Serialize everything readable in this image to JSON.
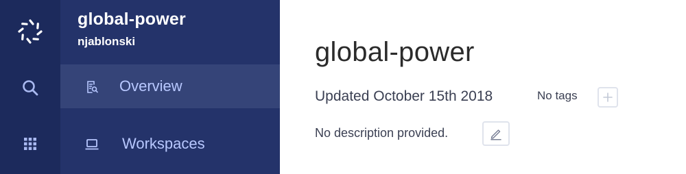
{
  "colors": {
    "rail_bg": "#1c2a5c",
    "sidebar_bg": "#24336a",
    "active_item_bg": "#354478",
    "nav_label": "#b8c8ff",
    "icon_light": "#a9b9f0",
    "text_dark": "#2b2b2b"
  },
  "rail": {
    "items": [
      {
        "icon": "logo-icon"
      },
      {
        "icon": "search-icon"
      },
      {
        "icon": "apps-grid-icon"
      }
    ]
  },
  "sidebar": {
    "project_name": "global-power",
    "owner": "njablonski",
    "nav": [
      {
        "label": "Overview",
        "icon": "overview-icon",
        "active": true
      },
      {
        "label": "Workspaces",
        "icon": "laptop-icon",
        "active": false
      }
    ]
  },
  "main": {
    "title": "global-power",
    "updated": "Updated October 15th 2018",
    "tags_label": "No tags",
    "add_tag_icon": "plus-icon",
    "description": "No description provided.",
    "edit_icon": "pencil-icon"
  }
}
